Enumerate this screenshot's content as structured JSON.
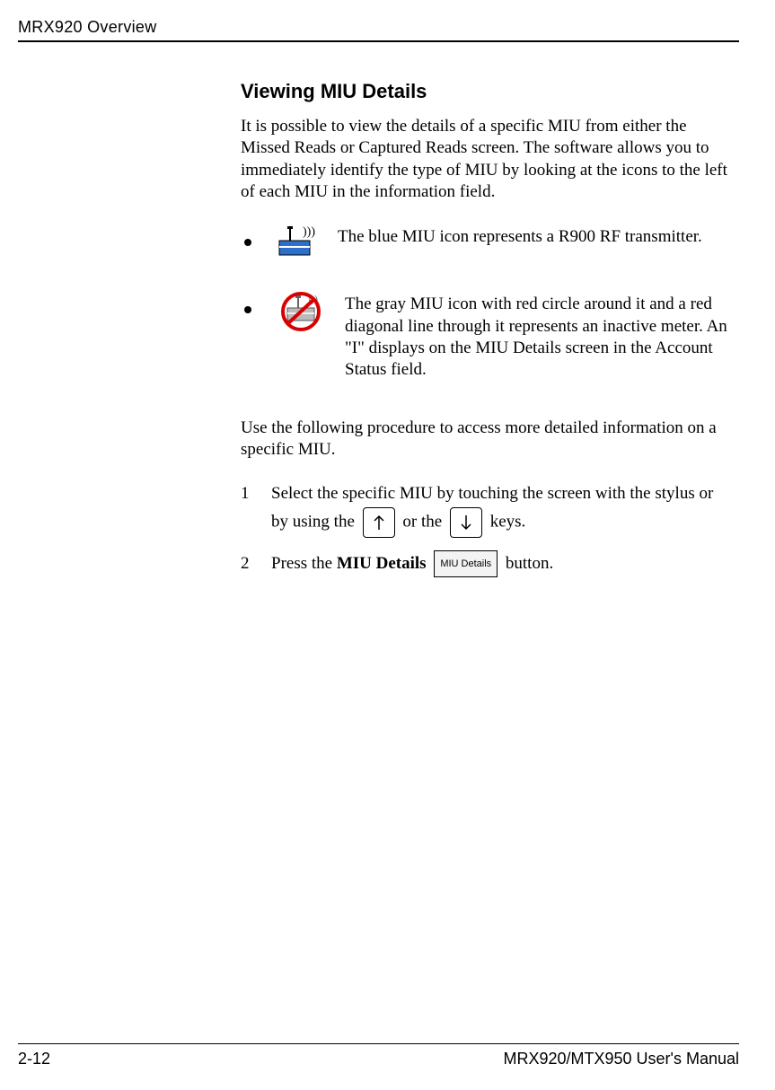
{
  "header": {
    "running_head": "MRX920 Overview"
  },
  "section": {
    "title": "Viewing MIU Details",
    "intro": "It is possible to view the details of a specific MIU from either the Missed Reads or Captured Reads screen. The software allows you to immediately identify the type of MIU by looking at the icons to the left of each MIU in the information field.",
    "bullet1": "The blue MIU icon represents a R900 RF transmitter.",
    "bullet2": "The gray MIU icon with red circle around it and a red diagonal line through it represents an inactive meter. An \"I\" displays on the MIU Details screen in the Account Status field.",
    "procedure_lead": "Use the following procedure to access more detailed information on a specific MIU.",
    "step1_pre1": "Select the specific MIU by touching the screen with the stylus or by using the ",
    "step1_mid": " or the ",
    "step1_post": " keys.",
    "step2_pre": "Press the ",
    "step2_bold": "MIU Details",
    "step2_post": " button.",
    "button_label": "MIU Details",
    "step_nums": {
      "one": "1",
      "two": "2"
    }
  },
  "footer": {
    "page": "2-12",
    "doc": "MRX920/MTX950 User's Manual"
  }
}
